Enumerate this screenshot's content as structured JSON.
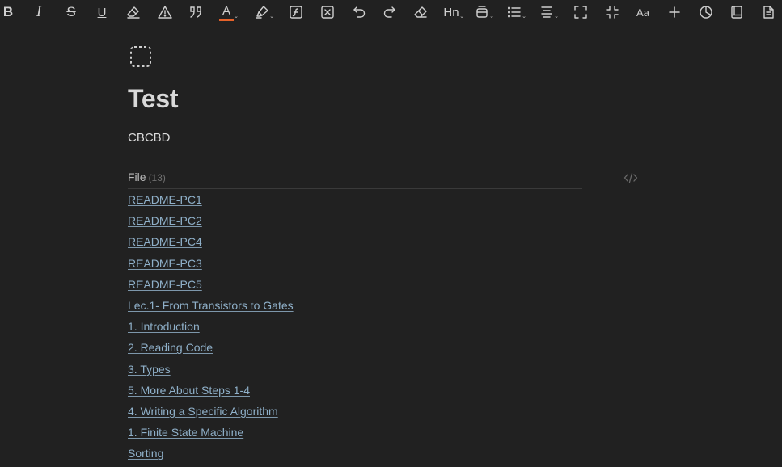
{
  "toolbar": {
    "buttons": [
      {
        "name": "bold",
        "label": "B"
      },
      {
        "name": "italic",
        "label": "I"
      },
      {
        "name": "strikethrough",
        "label": "S"
      },
      {
        "name": "underline",
        "label": "U"
      },
      {
        "name": "eraser-brush",
        "label": ""
      },
      {
        "name": "warning",
        "label": ""
      },
      {
        "name": "quote",
        "label": ""
      },
      {
        "name": "font-color",
        "label": "A"
      },
      {
        "name": "highlight",
        "label": ""
      },
      {
        "name": "formula",
        "label": ""
      },
      {
        "name": "clear-box",
        "label": ""
      },
      {
        "name": "undo",
        "label": ""
      },
      {
        "name": "redo",
        "label": ""
      },
      {
        "name": "eraser",
        "label": ""
      },
      {
        "name": "heading",
        "label": "Hn"
      },
      {
        "name": "block-format",
        "label": ""
      },
      {
        "name": "bullet-list",
        "label": ""
      },
      {
        "name": "align",
        "label": ""
      },
      {
        "name": "fullscreen",
        "label": ""
      },
      {
        "name": "exit-fullscreen",
        "label": ""
      },
      {
        "name": "font-size",
        "label": "Aa"
      },
      {
        "name": "add",
        "label": "+"
      },
      {
        "name": "pie-chart",
        "label": ""
      },
      {
        "name": "book",
        "label": ""
      },
      {
        "name": "document",
        "label": ""
      }
    ],
    "accent_color": "#e5622a"
  },
  "page": {
    "title": "Test",
    "subtitle": "CBCBD"
  },
  "file_section": {
    "label": "File",
    "count": "(13)"
  },
  "files": [
    "README-PC1",
    "README-PC2",
    "README-PC4",
    "README-PC3",
    "README-PC5",
    "Lec.1- From Transistors to Gates",
    "1. Introduction",
    "2. Reading Code",
    "3. Types",
    "5. More About Steps 1-4",
    "4. Writing a Specific Algorithm",
    "1. Finite State Machine",
    "Sorting"
  ]
}
